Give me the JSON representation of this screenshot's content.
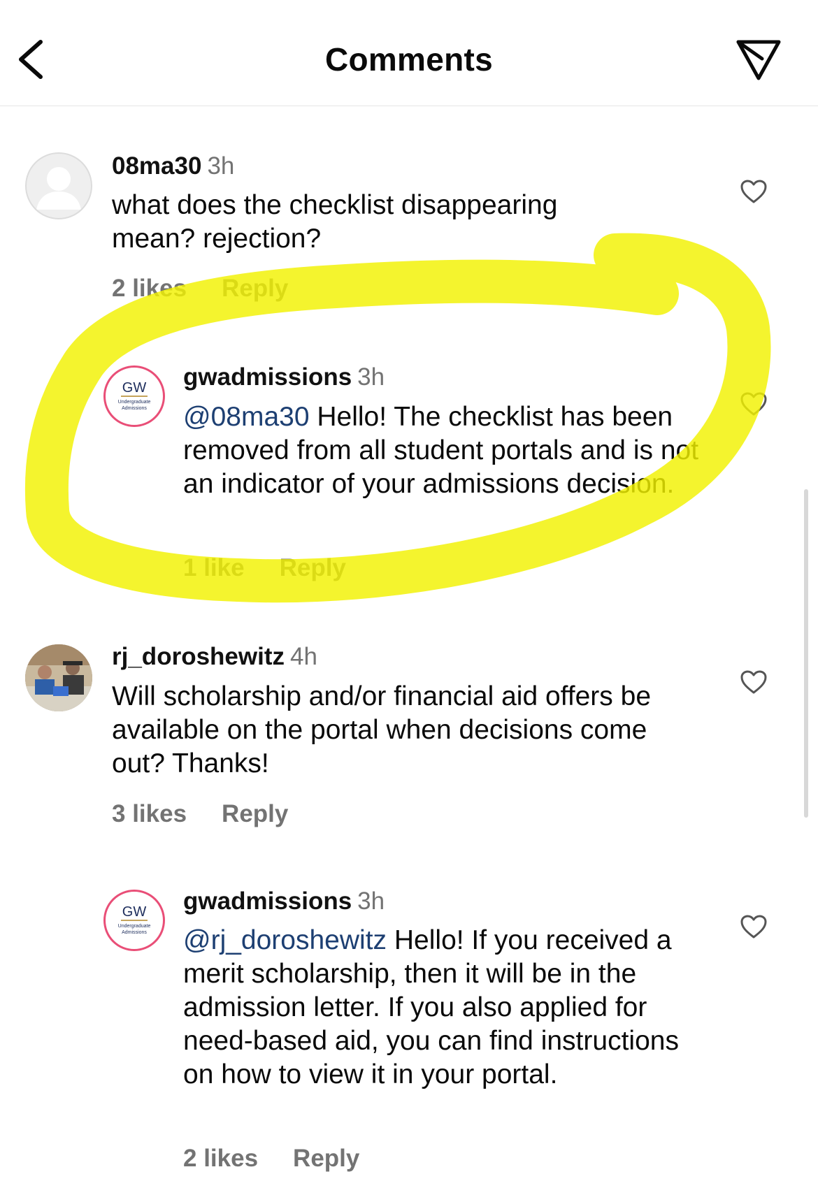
{
  "header": {
    "title": "Comments"
  },
  "comments": [
    {
      "username": "08ma30",
      "time": "3h",
      "text": "what does the checklist disappearing mean? rejection?",
      "likes": "2 likes",
      "reply": "Reply"
    },
    {
      "username": "gwadmissions",
      "time": "3h",
      "mention": "@08ma30",
      "text": " Hello! The checklist has been removed from all student portals and is not an indicator of your admissions decision.",
      "likes": "1 like",
      "reply": "Reply",
      "avatar": {
        "logo": "GW",
        "subtitle": "Undergraduate Admissions"
      }
    },
    {
      "username": "rj_doroshewitz",
      "time": "4h",
      "text": "Will scholarship and/or financial aid offers be available on the portal when decisions come out? Thanks!",
      "likes": "3 likes",
      "reply": "Reply"
    },
    {
      "username": "gwadmissions",
      "time": "3h",
      "mention": "@rj_doroshewitz",
      "text": " Hello! If you received a merit scholarship, then it will be in the admission letter. If you also applied for need-based aid, you can find instructions on how to view it in your portal.",
      "likes": "2 likes",
      "reply": "Reply",
      "avatar": {
        "logo": "GW",
        "subtitle": "Undergraduate Admissions"
      }
    }
  ],
  "colors": {
    "highlight": "#f2f200",
    "mention": "#1d3f72",
    "secondary_text": "#737373"
  },
  "icons": [
    "back-arrow-icon",
    "send-icon",
    "heart-icon",
    "default-avatar-icon"
  ]
}
